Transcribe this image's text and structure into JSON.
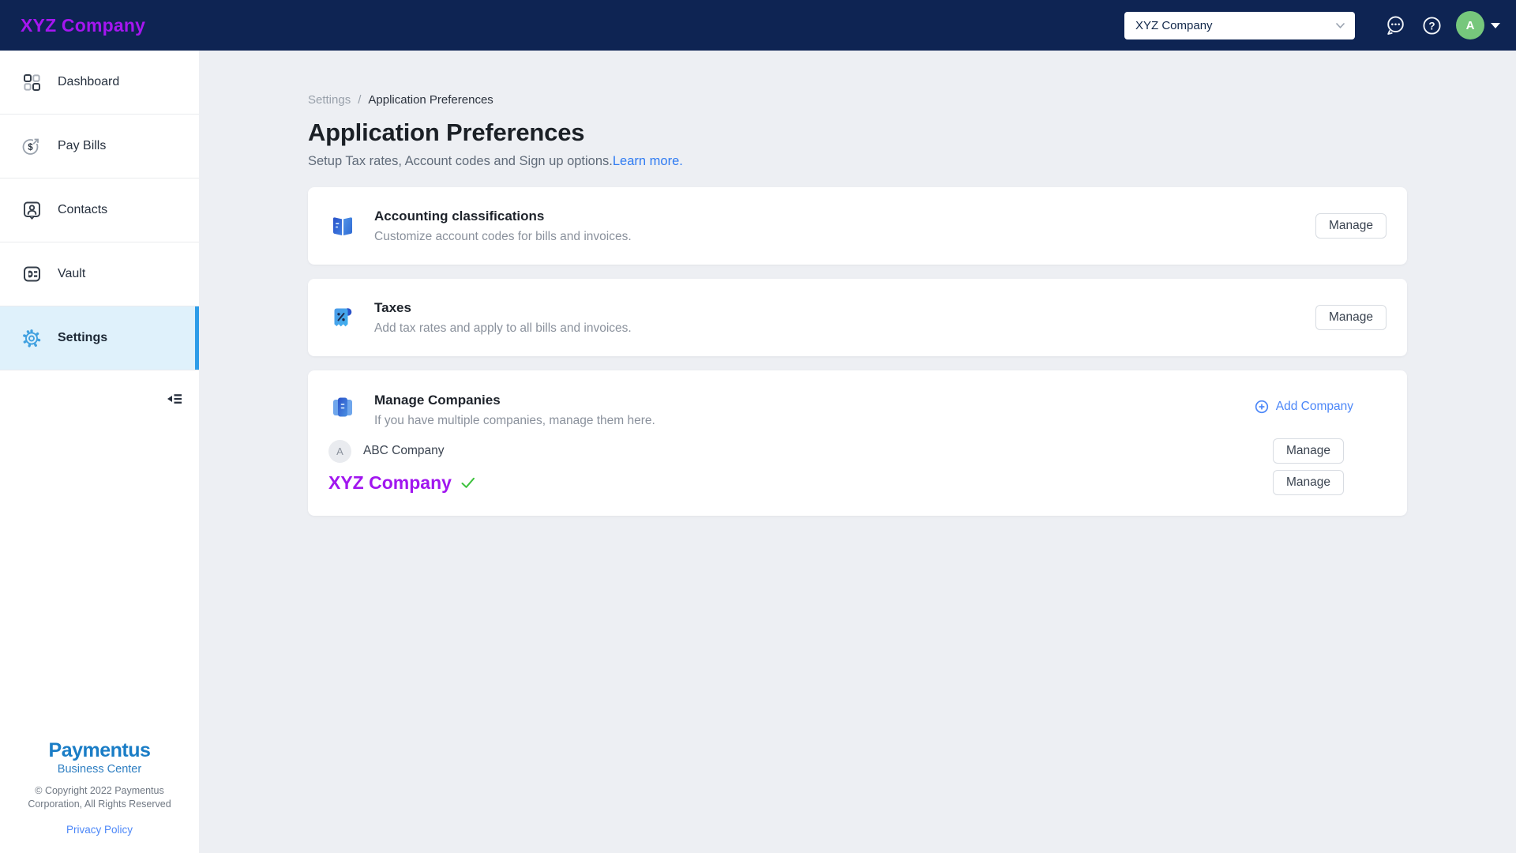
{
  "topbar": {
    "logo": "XYZ Company",
    "company_selector_value": "XYZ Company",
    "avatar_initial": "A"
  },
  "sidebar": {
    "items": [
      {
        "label": "Dashboard"
      },
      {
        "label": "Pay Bills"
      },
      {
        "label": "Contacts"
      },
      {
        "label": "Vault"
      },
      {
        "label": "Settings",
        "active": true
      }
    ],
    "footer": {
      "brand": "Paymentus",
      "brand_sub": "Business Center",
      "copyright_line1": "© Copyright 2022 Paymentus",
      "copyright_line2": "Corporation, All Rights Reserved",
      "privacy": "Privacy Policy"
    }
  },
  "main": {
    "breadcrumb": {
      "parent": "Settings",
      "separator": "/",
      "current": "Application Preferences"
    },
    "title": "Application Preferences",
    "subtitle": "Setup Tax rates, Account codes and Sign up options.",
    "learn_more": "Learn more.",
    "cards": [
      {
        "title": "Accounting classifications",
        "description": "Customize account codes for bills and invoices.",
        "action": "Manage"
      },
      {
        "title": "Taxes",
        "description": "Add tax rates and apply to all bills and invoices.",
        "action": "Manage"
      },
      {
        "title": "Manage Companies",
        "description": "If you have multiple companies, manage them here.",
        "add_company": "Add Company",
        "companies": [
          {
            "initial": "A",
            "name": "ABC Company",
            "action": "Manage",
            "selected": false
          },
          {
            "name": "XYZ Company",
            "action": "Manage",
            "selected": true
          }
        ]
      }
    ]
  },
  "colors": {
    "topbar_navy": "#0E2453",
    "brand_magenta": "#A516F0",
    "selected_company_magenta": "#A116EF",
    "active_item_bg": "#DFF1FB",
    "active_indicator_blue": "#2D9CE8",
    "link_blue": "#4C87F8",
    "learn_more_blue": "#2F7BF2",
    "paymentus_blue": "#1A7DC6",
    "avatar_green": "#76C77C",
    "check_green": "#3EC23E",
    "content_bg": "#EDEFF3"
  }
}
